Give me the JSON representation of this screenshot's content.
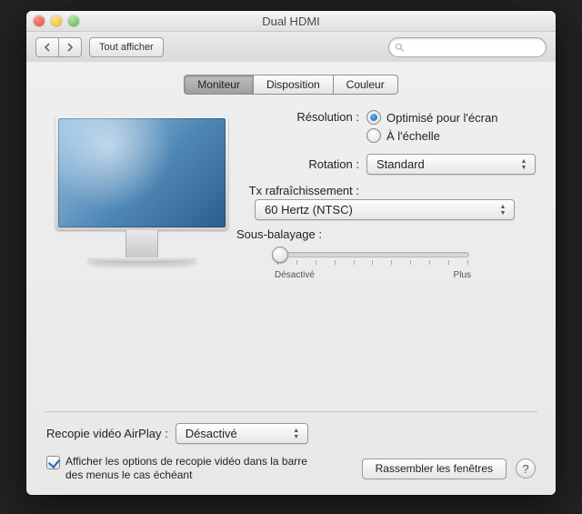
{
  "window": {
    "title": "Dual HDMI"
  },
  "toolbar": {
    "show_all": "Tout afficher",
    "search_placeholder": ""
  },
  "tabs": {
    "monitor": "Moniteur",
    "layout": "Disposition",
    "color": "Couleur"
  },
  "labels": {
    "resolution": "Résolution :",
    "rotation": "Rotation :",
    "refresh": "Tx rafraîchissement :",
    "underscan": "Sous-balayage :"
  },
  "resolution": {
    "best": "Optimisé pour l'écran",
    "scaled": "À l'échelle",
    "selected": "best"
  },
  "rotation": {
    "value": "Standard"
  },
  "refresh": {
    "value": "60 Hertz (NTSC)"
  },
  "underscan": {
    "min_label": "Désactivé",
    "max_label": "Plus"
  },
  "airplay": {
    "label": "Recopie vidéo AirPlay :",
    "value": "Désactivé"
  },
  "checkbox": {
    "label": "Afficher les options de recopie vidéo dans la barre des menus le cas échéant",
    "checked": true
  },
  "buttons": {
    "gather": "Rassembler les fenêtres",
    "help": "?"
  }
}
